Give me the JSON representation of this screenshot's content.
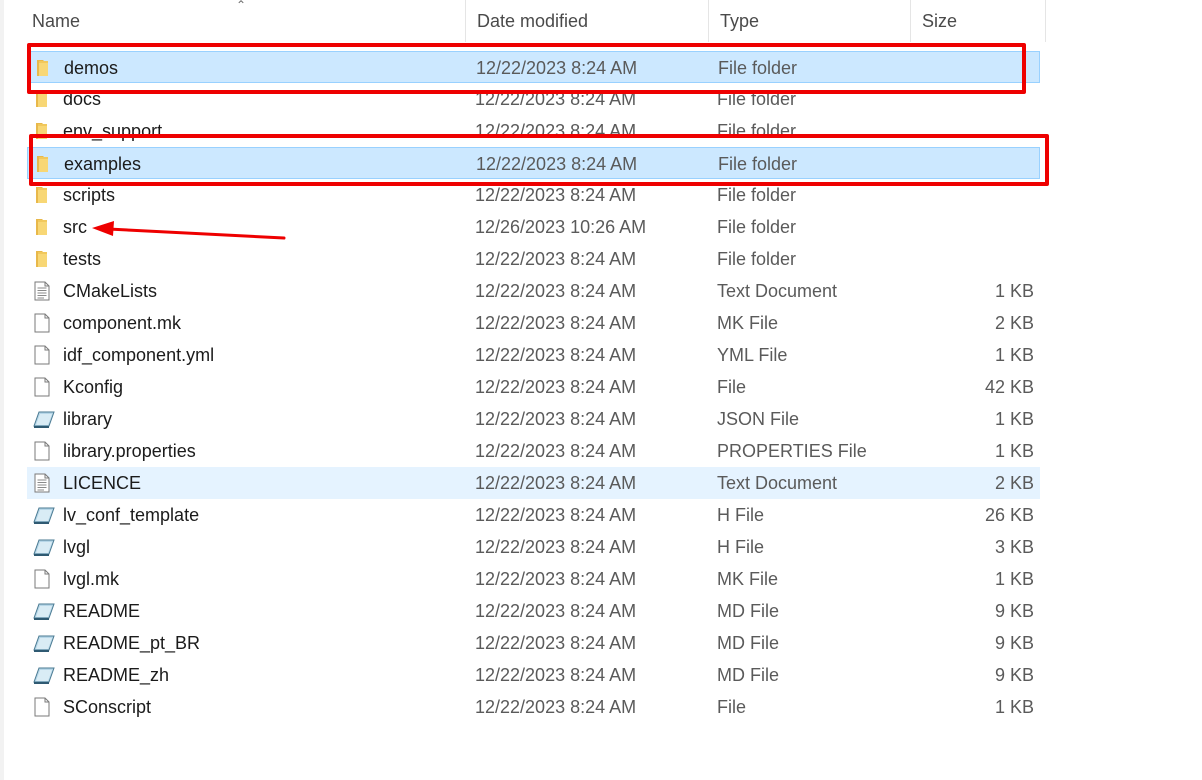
{
  "columns": {
    "name": "Name",
    "date": "Date modified",
    "type": "Type",
    "size": "Size"
  },
  "files": [
    {
      "name": "demos",
      "date": "12/22/2023 8:24 AM",
      "type": "File folder",
      "size": "",
      "icon": "folder-icon",
      "state": "selected"
    },
    {
      "name": "docs",
      "date": "12/22/2023 8:24 AM",
      "type": "File folder",
      "size": "",
      "icon": "folder-icon",
      "state": ""
    },
    {
      "name": "env_support",
      "date": "12/22/2023 8:24 AM",
      "type": "File folder",
      "size": "",
      "icon": "folder-icon",
      "state": ""
    },
    {
      "name": "examples",
      "date": "12/22/2023 8:24 AM",
      "type": "File folder",
      "size": "",
      "icon": "folder-icon",
      "state": "selected"
    },
    {
      "name": "scripts",
      "date": "12/22/2023 8:24 AM",
      "type": "File folder",
      "size": "",
      "icon": "folder-icon",
      "state": ""
    },
    {
      "name": "src",
      "date": "12/26/2023 10:26 AM",
      "type": "File folder",
      "size": "",
      "icon": "folder-icon",
      "state": ""
    },
    {
      "name": "tests",
      "date": "12/22/2023 8:24 AM",
      "type": "File folder",
      "size": "",
      "icon": "folder-icon",
      "state": ""
    },
    {
      "name": "CMakeLists",
      "date": "12/22/2023 8:24 AM",
      "type": "Text Document",
      "size": "1 KB",
      "icon": "text-document-icon",
      "state": ""
    },
    {
      "name": "component.mk",
      "date": "12/22/2023 8:24 AM",
      "type": "MK File",
      "size": "2 KB",
      "icon": "blank-file-icon",
      "state": ""
    },
    {
      "name": "idf_component.yml",
      "date": "12/22/2023 8:24 AM",
      "type": "YML File",
      "size": "1 KB",
      "icon": "blank-file-icon",
      "state": ""
    },
    {
      "name": "Kconfig",
      "date": "12/22/2023 8:24 AM",
      "type": "File",
      "size": "42 KB",
      "icon": "blank-file-icon",
      "state": ""
    },
    {
      "name": "library",
      "date": "12/22/2023 8:24 AM",
      "type": "JSON File",
      "size": "1 KB",
      "icon": "editor-file-icon",
      "state": ""
    },
    {
      "name": "library.properties",
      "date": "12/22/2023 8:24 AM",
      "type": "PROPERTIES File",
      "size": "1 KB",
      "icon": "blank-file-icon",
      "state": ""
    },
    {
      "name": "LICENCE",
      "date": "12/22/2023 8:24 AM",
      "type": "Text Document",
      "size": "2 KB",
      "icon": "text-document-icon",
      "state": "hover"
    },
    {
      "name": "lv_conf_template",
      "date": "12/22/2023 8:24 AM",
      "type": "H File",
      "size": "26 KB",
      "icon": "editor-file-icon",
      "state": ""
    },
    {
      "name": "lvgl",
      "date": "12/22/2023 8:24 AM",
      "type": "H File",
      "size": "3 KB",
      "icon": "editor-file-icon",
      "state": ""
    },
    {
      "name": "lvgl.mk",
      "date": "12/22/2023 8:24 AM",
      "type": "MK File",
      "size": "1 KB",
      "icon": "blank-file-icon",
      "state": ""
    },
    {
      "name": "README",
      "date": "12/22/2023 8:24 AM",
      "type": "MD File",
      "size": "9 KB",
      "icon": "editor-file-icon",
      "state": ""
    },
    {
      "name": "README_pt_BR",
      "date": "12/22/2023 8:24 AM",
      "type": "MD File",
      "size": "9 KB",
      "icon": "editor-file-icon",
      "state": ""
    },
    {
      "name": "README_zh",
      "date": "12/22/2023 8:24 AM",
      "type": "MD File",
      "size": "9 KB",
      "icon": "editor-file-icon",
      "state": ""
    },
    {
      "name": "SConscript",
      "date": "12/22/2023 8:24 AM",
      "type": "File",
      "size": "1 KB",
      "icon": "blank-file-icon",
      "state": ""
    }
  ],
  "colors": {
    "selection": "#cce8ff",
    "hover": "#e5f3ff",
    "annotation": "#ee0000",
    "folder": "#f8d775"
  }
}
